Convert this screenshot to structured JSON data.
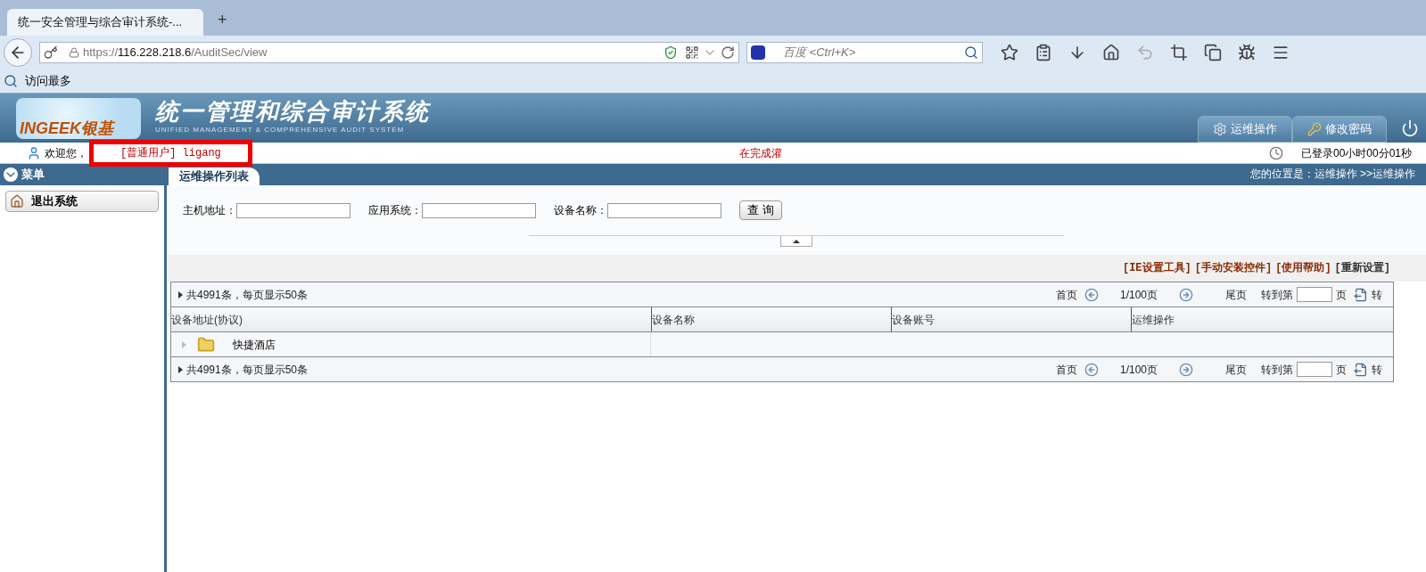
{
  "browser": {
    "tab_title": "统一安全管理与综合审计系统-...",
    "new_tab": "+",
    "url_host": "https://",
    "url_domain": "116.228.218.6",
    "url_path": "/AuditSec/view",
    "search_placeholder": "百度 <Ctrl+K>",
    "bookmark": "访问最多"
  },
  "header": {
    "logo_text": "INGEEK银基",
    "title": "统一管理和综合审计系统",
    "subtitle": "UNIFIED MANAGEMENT & COMPREHENSIVE AUDIT SYSTEM",
    "nav": [
      {
        "label": "运维操作",
        "kind": "gear"
      },
      {
        "label": "修改密码",
        "kind": "key"
      }
    ]
  },
  "user_bar": {
    "welcome": "欢迎您，",
    "role_user": "[普通用户] ligang",
    "status": "在完成灌",
    "login_time": "已登录00小时00分01秒"
  },
  "sidebar": {
    "title": "菜单",
    "items": [
      {
        "label": "退出系统"
      }
    ]
  },
  "panel": {
    "tab": "运维操作列表",
    "breadcrumb": "您的位置是：运维操作 >>运维操作",
    "filters": [
      {
        "label": "主机地址："
      },
      {
        "label": "应用系统："
      },
      {
        "label": "设备名称："
      }
    ],
    "query_button": "查 询",
    "links": [
      "[IE设置工具]",
      "[手动安装控件]",
      "[使用帮助]",
      "[重新设置]"
    ],
    "pagers": [
      {
        "summary": "共4991条，每页显示50条",
        "first": "首页",
        "page": "1/100页",
        "last": "尾页",
        "goto": "转到第",
        "page_unit": "页",
        "go": "转"
      },
      {
        "summary": "共4991条，每页显示50条",
        "first": "首页",
        "page": "1/100页",
        "last": "尾页",
        "goto": "转到第",
        "page_unit": "页",
        "go": "转"
      }
    ],
    "columns": [
      "设备地址(协议)",
      "设备名称",
      "设备账号",
      "运维操作"
    ],
    "rows": [
      {
        "name": "快捷酒店",
        "expanded": false
      }
    ]
  }
}
